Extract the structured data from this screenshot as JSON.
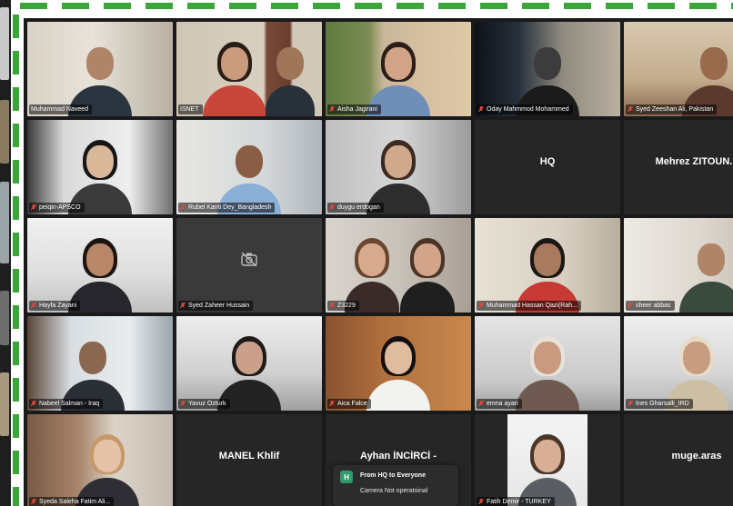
{
  "colors": {
    "frame_dash": "#3aa63a",
    "active_speaker": "#d8d86a",
    "muted_mic": "#e0483e",
    "tile_bg": "#232323",
    "chat_avatar": "#2f9a6d"
  },
  "icons": {
    "mic": "microphone-muted-icon",
    "camera_off": "camera-off-icon"
  },
  "participants": [
    {
      "name": "Muhammad Naveed"
    },
    {
      "name": "ISNET"
    },
    {
      "name": "Aisha Jagirani"
    },
    {
      "name": "Oday Mahmmod Mohammed"
    },
    {
      "name": "Syed Zeeshan Ali, Pakistan"
    },
    {
      "name": "peiqin-APSCO"
    },
    {
      "name": "Rubel Kanti Dey_Bangladesh"
    },
    {
      "name": "duygu erdogan"
    },
    {
      "name": "HQ"
    },
    {
      "name": "Mehrez ZITOUN..."
    },
    {
      "name": "Hayfa Zayani"
    },
    {
      "name": "Syed Zaheer Hussain"
    },
    {
      "name": "Z3229"
    },
    {
      "name": "Muhammad Hassan Qazi(Rah..."
    },
    {
      "name": "sheer abbas"
    },
    {
      "name": "Nabeel Salman - Iraq"
    },
    {
      "name": "Yavuz Ozturk"
    },
    {
      "name": "Aica Falce"
    },
    {
      "name": "emna ayari"
    },
    {
      "name": "Ines Gharsalli_IRD"
    },
    {
      "name": "Syeda Saleha Fatim Ali..."
    },
    {
      "name": "MANEL Khlif"
    },
    {
      "name": "Ayhan İNCİRCİ -"
    },
    {
      "name": "Fatih Demir - TURKEY"
    },
    {
      "name": "muge.aras"
    }
  ],
  "chat": {
    "avatar_letter": "H",
    "title": "From HQ to Everyone",
    "message": "Camera Not operatoinal"
  }
}
